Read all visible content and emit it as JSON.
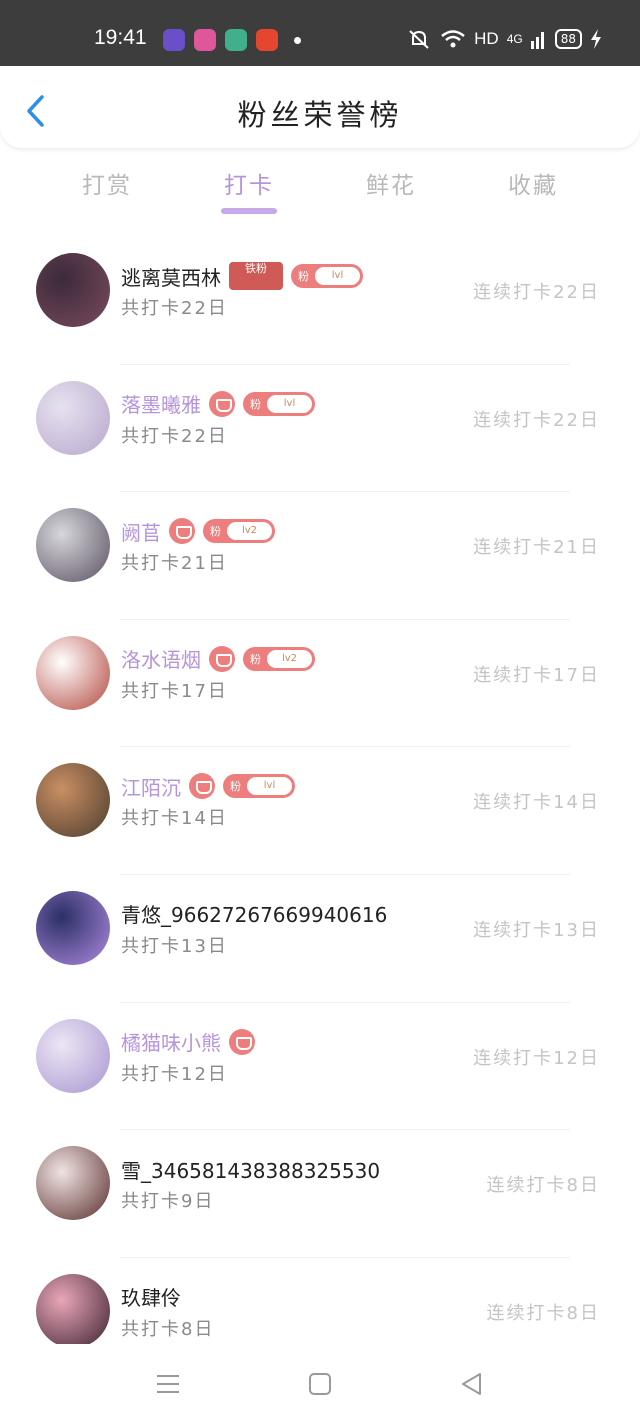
{
  "status_bar": {
    "time": "19:41",
    "network": "HD",
    "signal": "4G",
    "battery": "88",
    "apps": [
      {
        "icon": "circle-app-icon",
        "color": "#6a4fc9"
      },
      {
        "icon": "flower-app-icon",
        "color": "#e0569a"
      },
      {
        "icon": "book-app-icon",
        "color": "#3fb08b"
      },
      {
        "icon": "crab-app-icon",
        "color": "#e5462f"
      }
    ]
  },
  "header": {
    "title": "粉丝荣誉榜",
    "back_icon": "chevron-left-icon"
  },
  "tabs": [
    {
      "label": "打赏",
      "active": false
    },
    {
      "label": "打卡",
      "active": true
    },
    {
      "label": "鲜花",
      "active": false
    },
    {
      "label": "收藏",
      "active": false
    }
  ],
  "ranking": [
    {
      "name": "逃离莫西林",
      "vip": false,
      "gem": false,
      "iron": "铁粉",
      "fan_level": "lvl",
      "total": "共打卡22日",
      "streak": "连续打卡22日",
      "avatar_colors": [
        "#3b2a3a",
        "#7a4b5e"
      ]
    },
    {
      "name": "落墨曦雅",
      "vip": true,
      "gem": true,
      "iron": "",
      "fan_level": "lvl",
      "total": "共打卡22日",
      "streak": "连续打卡22日",
      "avatar_colors": [
        "#e6e2ef",
        "#b7a6cc"
      ]
    },
    {
      "name": "阙苢",
      "vip": true,
      "gem": true,
      "iron": "",
      "fan_level": "lv2",
      "total": "共打卡21日",
      "streak": "连续打卡21日",
      "avatar_colors": [
        "#d7d7dc",
        "#5a5060"
      ]
    },
    {
      "name": "洛水语烟",
      "vip": true,
      "gem": true,
      "iron": "",
      "fan_level": "lv2",
      "total": "共打卡17日",
      "streak": "连续打卡17日",
      "avatar_colors": [
        "#ffffff",
        "#b3473d"
      ]
    },
    {
      "name": "江陌沉",
      "vip": true,
      "gem": true,
      "iron": "",
      "fan_level": "lvl",
      "total": "共打卡14日",
      "streak": "连续打卡14日",
      "avatar_colors": [
        "#c98f63",
        "#4b3c2e"
      ]
    },
    {
      "name": "青悠_96627267669940616",
      "vip": false,
      "gem": false,
      "iron": "",
      "fan_level": "",
      "total": "共打卡13日",
      "streak": "连续打卡13日",
      "avatar_colors": [
        "#2b2f66",
        "#b08be0"
      ]
    },
    {
      "name": "橘猫味小熊",
      "vip": true,
      "gem": true,
      "iron": "",
      "fan_level": "",
      "total": "共打卡12日",
      "streak": "连续打卡12日",
      "avatar_colors": [
        "#ece6f4",
        "#a895d1"
      ]
    },
    {
      "name": "雪_346581438388325530",
      "vip": false,
      "gem": false,
      "iron": "",
      "fan_level": "",
      "total": "共打卡9日",
      "streak": "连续打卡8日",
      "avatar_colors": [
        "#efe4e2",
        "#5a2d2d"
      ]
    },
    {
      "name": "玖肆伶",
      "vip": false,
      "gem": false,
      "iron": "",
      "fan_level": "",
      "total": "共打卡8日",
      "streak": "连续打卡8日",
      "avatar_colors": [
        "#e9a7b8",
        "#3a2030"
      ]
    }
  ],
  "fan_prefix": "粉",
  "navbar": {
    "menu_icon": "menu-icon",
    "home_icon": "home-square-icon",
    "back_icon": "back-triangle-icon"
  }
}
